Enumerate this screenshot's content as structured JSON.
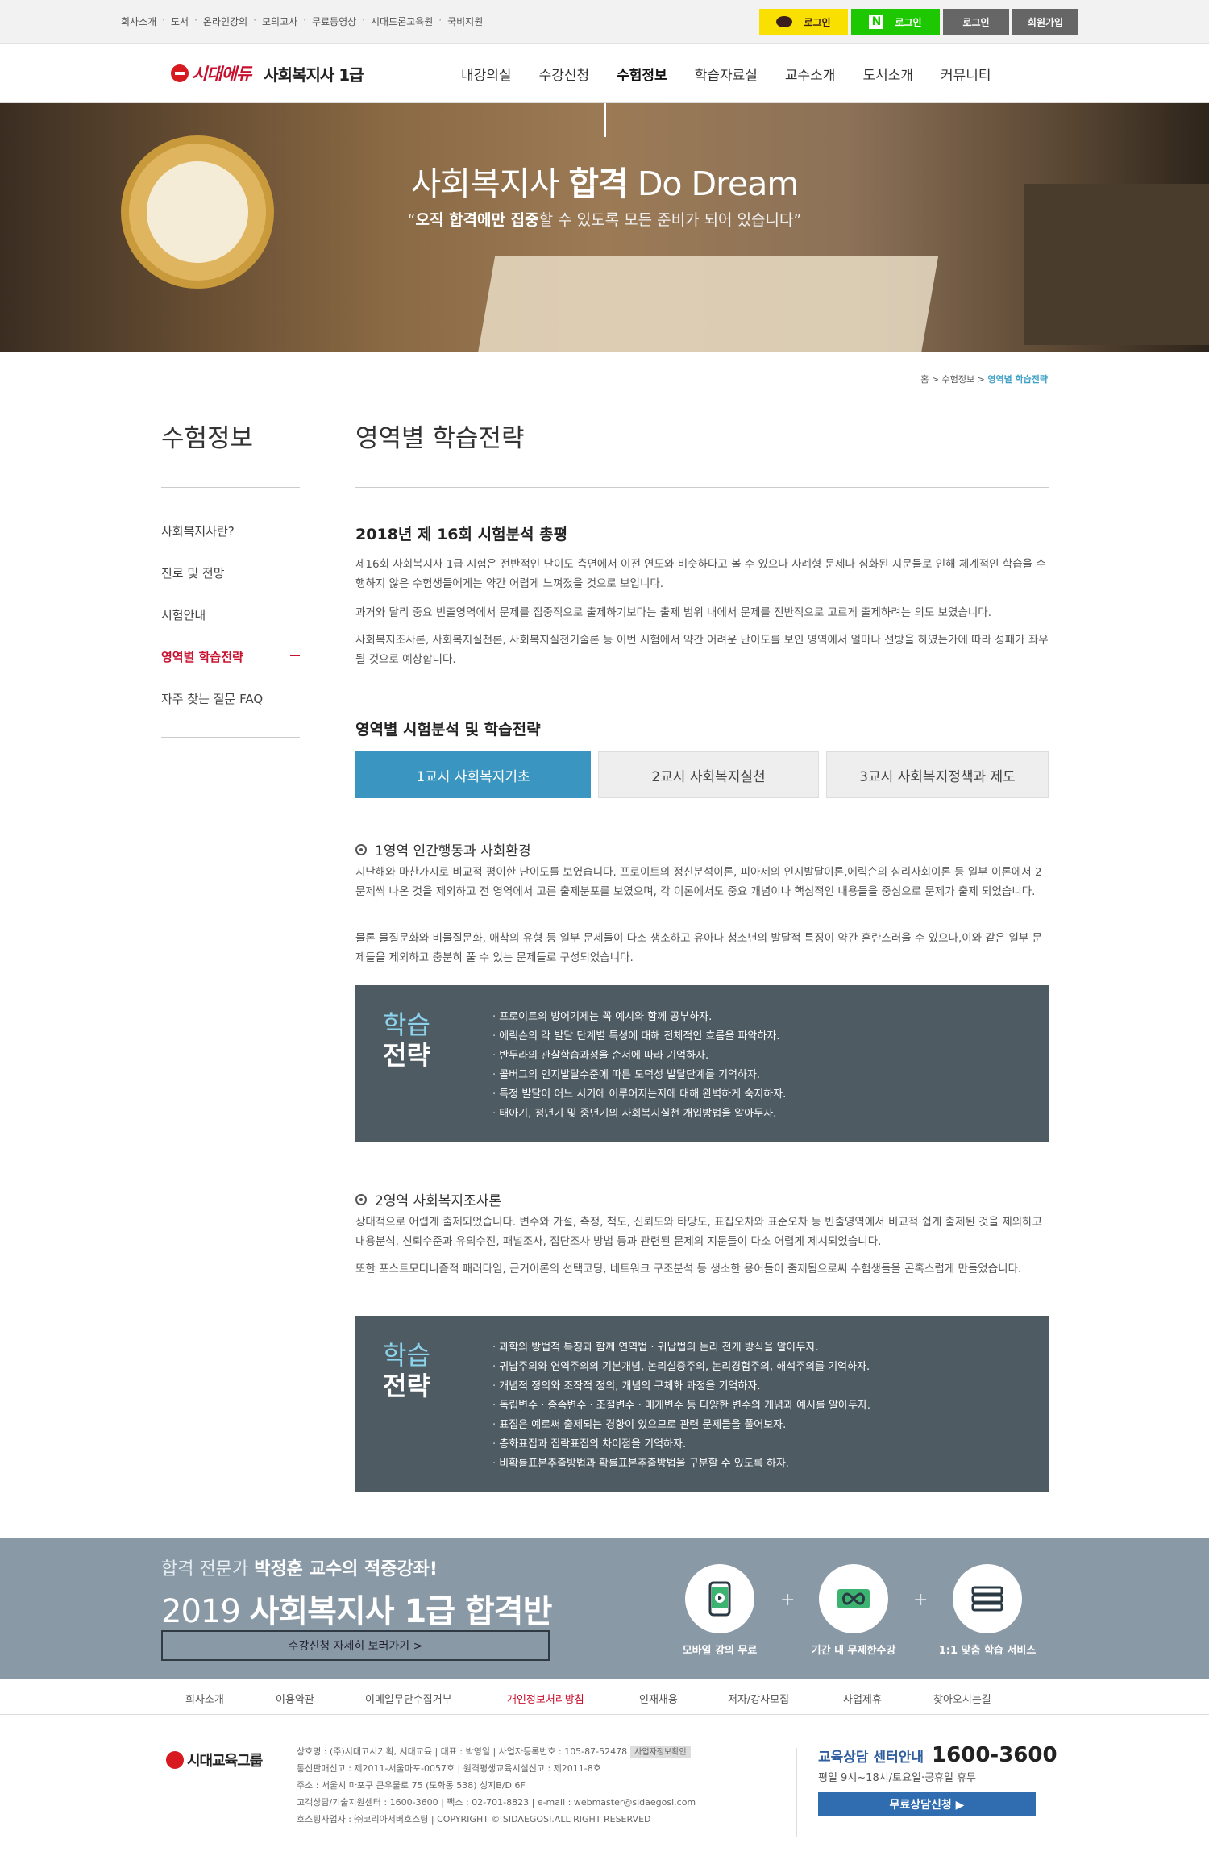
{
  "topbar": {
    "links": [
      "회사소개",
      "도서",
      "온라인강의",
      "모의고사",
      "무료동영상",
      "시대드론교육원",
      "국비지원"
    ],
    "kakao_login": "로그인",
    "naver_login": "로그인",
    "login": "로그인",
    "join": "회원가입"
  },
  "header": {
    "brand": "시대에듀",
    "site_title": "사회복지사 1급",
    "nav": [
      "내강의실",
      "수강신청",
      "수험정보",
      "학습자료실",
      "교수소개",
      "도서소개",
      "커뮤니티"
    ]
  },
  "hero": {
    "title_light": "사회복지사",
    "title_bold": "합격",
    "title_tail": "Do Dream",
    "sub_quote_open": "“",
    "sub_bold": "오직 합격에만 집중",
    "sub_rest": "할 수 있도록 모든 준비가 되어 있습니다”"
  },
  "breadcrumb": {
    "home": "홈",
    "sep": ">",
    "parent": "수험정보",
    "current": "영역별 학습전략"
  },
  "lnb": {
    "title": "수험정보",
    "items": [
      "사회복지사란?",
      "진로 및 전망",
      "시험안내",
      "영역별 학습전략",
      "자주 찾는 질문 FAQ"
    ]
  },
  "main": {
    "page_title": "영역별 학습전략",
    "overview_title": "2018년 제 16회 시험분석 총평",
    "overview_paragraphs": [
      "제16회 사회복지사 1급 시험은 전반적인 난이도 측면에서 이전 연도와 비슷하다고 볼 수 있으나 사례형 문제나 심화된 지문들로 인해 체계적인 학습을 수행하지 않은 수험생들에게는 약간 어렵게 느껴졌을 것으로 보입니다.",
      "과거와 달리 중요 빈출영역에서 문제를 집중적으로 출제하기보다는 출제 범위 내에서 문제를 전반적으로 고르게 출제하려는 의도 보였습니다.",
      "사회복지조사론, 사회복지실천론, 사회복지실천기술론 등 이번 시험에서 약간 어려운 난이도를 보인 영역에서 얼마나 선방을 하였는가에 따라 성패가 좌우될 것으로 예상합니다."
    ],
    "analysis_title": "영역별 시험분석 및 학습전략",
    "tabs": [
      "1교시 사회복지기초",
      "2교시 사회복지실천",
      "3교시 사회복지정책과 제도"
    ],
    "strategy_label_top": "학습",
    "strategy_label_bottom": "전략",
    "sections": [
      {
        "heading": "1영역 인간행동과 사회환경",
        "paragraphs": [
          "지난해와 마찬가지로 비교적 평이한 난이도를 보였습니다. 프로이트의 정신분석이론, 피아제의 인지발달이론,에릭슨의 심리사회이론 등 일부 이론에서 2문제씩 나온 것을 제외하고 전 영역에서 고른 출제분포를 보였으며, 각 이론에서도 중요 개념이나 핵심적인 내용들을 중심으로 문제가 출제 되었습니다.",
          "물론 물질문화와 비물질문화, 애착의 유형 등 일부 문제들이 다소 생소하고 유아나 청소년의 발달적 특징이 약간 혼란스러울 수 있으나,이와 같은 일부 문제들을 제외하고 충분히 풀 수 있는 문제들로 구성되었습니다."
        ],
        "strategies": [
          "프로이트의 방어기제는 꼭 예시와 함께 공부하자.",
          "에릭슨의 각 발달 단계별 특성에 대해 전체적인 흐름을 파악하자.",
          "반두라의 관찰학습과정을 순서에 따라 기억하자.",
          "콜버그의 인지발달수준에 따른 도덕성 발달단계를 기억하자.",
          "특정 발달이 어느 시기에 이루어지는지에 대해 완벽하게 숙지하자.",
          "태아기, 청년기 및 중년기의 사회복지실천 개입방법을 알아두자."
        ]
      },
      {
        "heading": "2영역 사회복지조사론",
        "paragraphs": [
          "상대적으로 어렵게 출제되었습니다. 변수와 가설, 측정, 척도, 신뢰도와 타당도, 표집오차와 표준오차 등 빈출영역에서 비교적 쉽게 출제된 것을 제외하고 내용분석, 신뢰수준과 유의수진, 패널조사, 집단조사 방법 등과 관련된 문제의 지문들이 다소 어렵게 제시되었습니다.",
          "또한 포스트모더니즘적 패러다임, 근거이론의 선택코딩, 네트워크 구조분석 등 생소한 용어들이 출제됨으로써 수험생들을 곤혹스럽게 만들었습니다."
        ],
        "strategies": [
          "과학의 방법적 특징과 함께 연역법 · 귀납법의 논리 전개 방식을 알아두자.",
          "귀납주의와 연역주의의 기본개념, 논리실증주의, 논리경험주의, 해석주의를 기억하자.",
          "개념적 정의와 조작적 정의, 개념의 구체화 과정을 기억하자.",
          "독립변수 · 종속변수 · 조절변수 · 매개변수 등 다양한 변수의 개념과 예시를 알아두자.",
          "표집은 예로써 출제되는 경향이 있으므로 관련 문제들을 풀어보자.",
          "층화표집과 집락표집의 차이점을 기억하자.",
          "비확률표본추출방법과 확률표본추출방법을 구분할 수 있도록 하자."
        ]
      }
    ]
  },
  "banner": {
    "line1_pre": "합격 전문가",
    "line1_bold": "박정훈 교수의 적중강좌!",
    "year": "2019",
    "course": "사회복지사 1급 합격반",
    "cta": "수강신청 자세히 보러가기  >",
    "features": [
      "모바일 강의 무료",
      "기간 내 무제한수강",
      "1:1 맞춤 학습 서비스"
    ],
    "plus": "+"
  },
  "footer": {
    "nav": [
      "회사소개",
      "이용약관",
      "이메일무단수집거부",
      "개인정보처리방침",
      "인재채용",
      "저자/강사모집",
      "사업제휴",
      "찾아오시는길"
    ],
    "logo_text": "시대교육그룹",
    "info": [
      "상호명 : (주)시대고시기획, 시대교육 | 대표 : 박영일 | 사업자등록번호 : 105-87-52478",
      "통신판매신고 : 제2011-서울마포-0057호 | 원격평생교육시설신고 : 제2011-8호",
      "주소 : 서울시 마포구 큰우물로 75 (도화동 538) 성지B/D 6F",
      "고객상담/기술지원센터 : 1600-3600 | 팩스 : 02-701-8823 | e-mail : webmaster@sidaegosi.com",
      "호스팅사업자 : ㈜코리아서버호스팅 | COPYRIGHT © SIDAEGOSI.ALL RIGHT RESERVED"
    ],
    "biz_tag": "사업자정보확인",
    "cs_title": "교육상담 센터안내",
    "cs_number": "1600-3600",
    "cs_hours": "평일 9시~18시/토요일·공휴일 휴무",
    "cs_button": "무료상담신청 ▶"
  }
}
